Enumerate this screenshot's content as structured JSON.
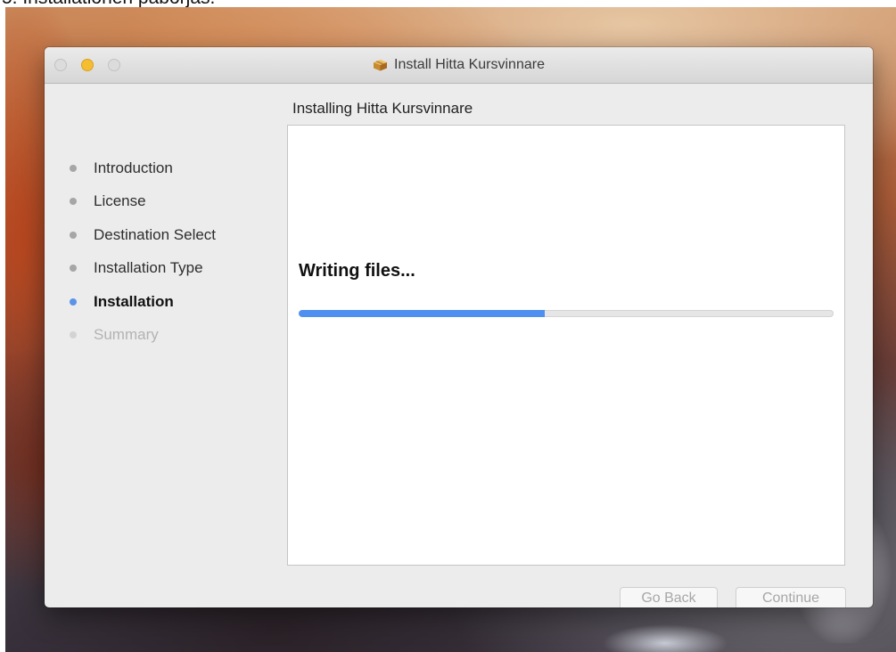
{
  "caption": "5. Installationen påbörjas.",
  "window": {
    "title": "Install Hitta Kursvinnare",
    "title_icon": "package-icon"
  },
  "sidebar": {
    "steps": [
      {
        "label": "Introduction",
        "state": "done"
      },
      {
        "label": "License",
        "state": "done"
      },
      {
        "label": "Destination Select",
        "state": "done"
      },
      {
        "label": "Installation Type",
        "state": "done"
      },
      {
        "label": "Installation",
        "state": "current"
      },
      {
        "label": "Summary",
        "state": "pending"
      }
    ]
  },
  "content": {
    "heading": "Installing Hitta Kursvinnare",
    "status": "Writing files...",
    "progress_fraction": 0.46
  },
  "buttons": {
    "back_label": "Go Back",
    "continue_label": "Continue",
    "enabled": false
  },
  "colors": {
    "accent": "#4f8ff0",
    "active_dot": "#5b93ea",
    "minimize": "#f5bd30"
  }
}
